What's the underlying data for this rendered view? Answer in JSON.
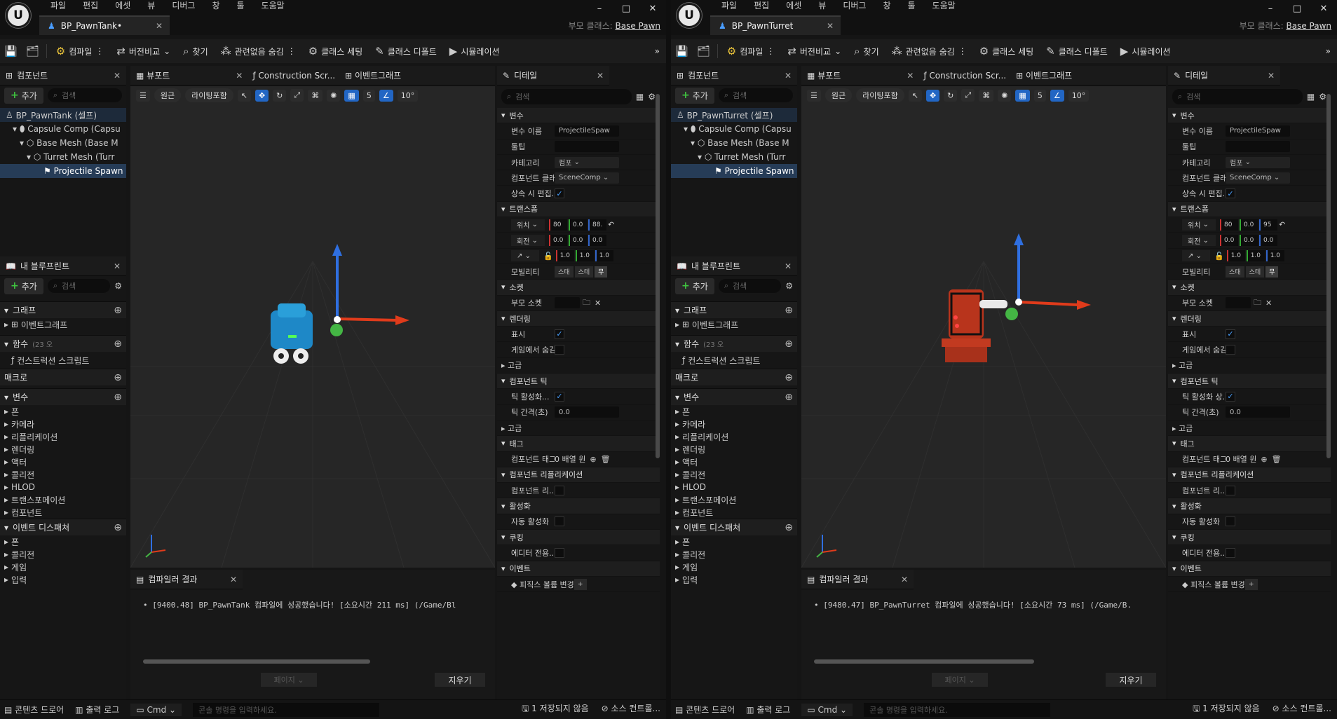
{
  "menu": [
    "파일",
    "편집",
    "에셋",
    "뷰",
    "디버그",
    "창",
    "툴",
    "도움말"
  ],
  "window_controls": [
    "–",
    "□",
    "✕"
  ],
  "parent_label": "부모 클래스:",
  "parent_value": "Base Pawn",
  "toolbar": {
    "compile": "컴파일",
    "diff": "버전비교",
    "find": "찾기",
    "hide": "관련없음 숨김",
    "class_settings": "클래스 세팅",
    "class_defaults": "클래스 디폴트",
    "simulate": "시뮬레이션"
  },
  "components_panel": {
    "title": "컴포넌트",
    "add": "추가",
    "search": "검색"
  },
  "viewport_tab": "뷰포트",
  "construction_tab": "Construction Scr...",
  "eventgraph_tab": "이벤트그래프",
  "viewport_bar": {
    "perspective": "원근",
    "lighting": "라이팅포함",
    "grid": "5",
    "angle": "10°"
  },
  "myblueprint": {
    "title": "내 블루프린트",
    "add": "추가",
    "search": "검색",
    "graph": "그래프",
    "eventgraph": "이벤트그래프",
    "functions": "함수",
    "functions_count": "(23 오",
    "construction": "컨스트럭션 스크립트",
    "macro": "매크로",
    "variables": "변수",
    "var_items": [
      "폰",
      "카메라",
      "리플리케이션",
      "렌더링",
      "액터",
      "콜리전",
      "HLOD",
      "트랜스포메이션",
      "컴포넌트"
    ],
    "dispatchers": "이벤트 디스패처",
    "disp_items": [
      "폰",
      "콜리전",
      "게임",
      "입력"
    ]
  },
  "compiler": {
    "title": "컴파일러 결과",
    "page": "페이지",
    "clear": "지우기"
  },
  "details": {
    "title": "디테일",
    "search": "검색",
    "variable": "변수",
    "var_name": "변수 이름",
    "var_name_val": "ProjectileSpaw",
    "tooltip": "툴팁",
    "category": "카테고리",
    "category_val": "컴포",
    "comp_class": "컴포넌트 클래",
    "comp_class_val": "SceneComp",
    "inherit_edit": "상속 시 편집...",
    "transform": "트랜스폼",
    "location": "위치",
    "rotation": "회전",
    "scale": "↗",
    "rot": [
      "0.0",
      "0.0",
      "0.0"
    ],
    "scl": [
      "1.0",
      "1.0",
      "1.0"
    ],
    "mobility": "모빌리티",
    "mob": [
      "스태",
      "스테",
      "무"
    ],
    "socket": "소켓",
    "parent_socket": "부모 소켓",
    "rendering": "렌더링",
    "visible": "표시",
    "hidden_in_game": "게임에서 숨김",
    "advanced": "고급",
    "component_tick": "컴포넌트 틱",
    "tick_interval": "틱 간격(초)",
    "tick_val": "0.0",
    "tags": "태그",
    "comp_tags": "컴포넌트 태그",
    "tags_val": "0 배열 원",
    "replication": "컴포넌트 리플리케이션",
    "comp_repl": "컴포넌트 리...",
    "activation": "활성화",
    "auto_activate": "자동 활성화",
    "cooking": "쿠킹",
    "editor_only": "에디터 전용...",
    "events": "이벤트",
    "physics_volume": "피직스 볼륨 변경"
  },
  "status": {
    "drawer": "콘텐츠 드로어",
    "log": "출력 로그",
    "cmd": "Cmd",
    "console": "콘솔 명령을 입력하세요.",
    "unsaved": "1 저장되지 않음",
    "source": "소스 컨트롤..."
  },
  "left": {
    "tab": "BP_PawnTank•",
    "tree": [
      "BP_PawnTank (셀프)",
      "Capsule Comp (Capsu",
      "Base Mesh (Base M",
      "Turret Mesh (Turr",
      "Projectile Spawn"
    ],
    "loc": [
      "80",
      "0.0",
      "88."
    ],
    "tick_enable": "틱 활성화...",
    "log": "• [9400.48] BP_PawnTank 컴파일에 성공했습니다! [소요시간 211 ms] (/Game/Bl"
  },
  "right": {
    "tab": "BP_PawnTurret",
    "tree": [
      "BP_PawnTurret (셀프)",
      "Capsule Comp (Capsu",
      "Base Mesh (Base M",
      "Turret Mesh (Turr",
      "Projectile Spawn"
    ],
    "loc": [
      "80",
      "0.0",
      "95"
    ],
    "tick_enable": "틱 활성화 상...",
    "log": "• [9480.47] BP_PawnTurret 컴파일에 성공했습니다! [소요시간 73 ms] (/Game/B."
  }
}
